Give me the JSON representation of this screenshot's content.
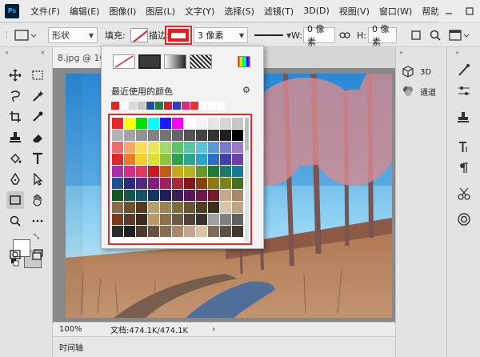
{
  "app": {
    "logo_text": "Ps"
  },
  "menu": [
    "文件(F)",
    "编辑(E)",
    "图像(I)",
    "图层(L)",
    "文字(Y)",
    "选择(S)",
    "滤镜(T)",
    "3D(D)",
    "视图(V)",
    "窗口(W)",
    "帮助"
  ],
  "options": {
    "shape_mode": "形状",
    "fill_label": "填充:",
    "stroke_label": "描边:",
    "stroke_size": "3 像素",
    "width_label": "W:",
    "width_value": "0 像素",
    "height_label": "H:",
    "height_value": "0 像素"
  },
  "document": {
    "tab_title": "8.jpg @ 10",
    "zoom": "100%",
    "doc_info": "文档:474.1K/474.1K",
    "status_arrow": "›",
    "timeline_label": "时间轴"
  },
  "right_panel": {
    "item_3d": "3D",
    "item_channels": "通道"
  },
  "color_popup": {
    "recent_label": "最近使用的颜色",
    "recent_colors": [
      "#e8262a",
      "#ffffff",
      "#d9d9d9",
      "#c8c8c8",
      "#1f4e9a",
      "#2c7a3a",
      "#cc2233",
      "#2a3fbf",
      "#d8287a",
      "#e83030",
      "#ffffff",
      "#ffffff",
      "#ffffff"
    ],
    "swatches": [
      "#e8262a",
      "#ffff00",
      "#00e000",
      "#00ffff",
      "#1a1aff",
      "#ff00ff",
      "#ffffff",
      "#f4f4f4",
      "#e6e6e6",
      "#d6d6d6",
      "#c6c6c6",
      "#b3b3b3",
      "#a3a3a3",
      "#939393",
      "#838383",
      "#737373",
      "#646464",
      "#545454",
      "#444444",
      "#333333",
      "#1f1f1f",
      "#000000",
      "#f06c6c",
      "#f8a76a",
      "#fcdc5e",
      "#e8e85a",
      "#a2d96b",
      "#5dc46b",
      "#5ac5a2",
      "#59c3d8",
      "#5c9ad6",
      "#7a7ad1",
      "#9a7ac7",
      "#e0262a",
      "#ef7a28",
      "#f5d22a",
      "#dce132",
      "#8ac63a",
      "#2ea24a",
      "#2ba58c",
      "#29a4c8",
      "#2a6fc2",
      "#3f3fae",
      "#6e3fa7",
      "#ab2bad",
      "#d72d87",
      "#e0385a",
      "#c31b1f",
      "#c55a17",
      "#c9a81a",
      "#b3b722",
      "#639b2a",
      "#1c7c37",
      "#1a7b68",
      "#197a95",
      "#1b4f8e",
      "#2a2a7e",
      "#4f2a7b",
      "#7c1f7d",
      "#9c1f63",
      "#a7273f",
      "#8a1316",
      "#8c4010",
      "#8f7812",
      "#7f8217",
      "#466d1e",
      "#125627",
      "#125649",
      "#115468",
      "#123763",
      "#1d1d58",
      "#381d57",
      "#571658",
      "#6e1646",
      "#75192c",
      "#c7a88a",
      "#a88866",
      "#8b6b4a",
      "#6e5134",
      "#55391f",
      "#b7a06e",
      "#9a8556",
      "#7f6c41",
      "#655530",
      "#4c3f21",
      "#37301a",
      "#d8c4a8",
      "#bfa585",
      "#7a3a1c",
      "#5c3a2a",
      "#3d2a1f",
      "#b99a6a",
      "#8f704a",
      "#6f5a44",
      "#50403a",
      "#3a302c",
      "#a0a0a0",
      "#808080",
      "#606060",
      "#2b2b2b",
      "#1f1f1f",
      "#4e3a2a",
      "#6a5040",
      "#896b52",
      "#a8876a",
      "#c4a586",
      "#dcc3a4",
      "#7d6a58",
      "#5f5042",
      "#43372d"
    ]
  },
  "colors": {
    "accent_red": "#e6282a"
  }
}
